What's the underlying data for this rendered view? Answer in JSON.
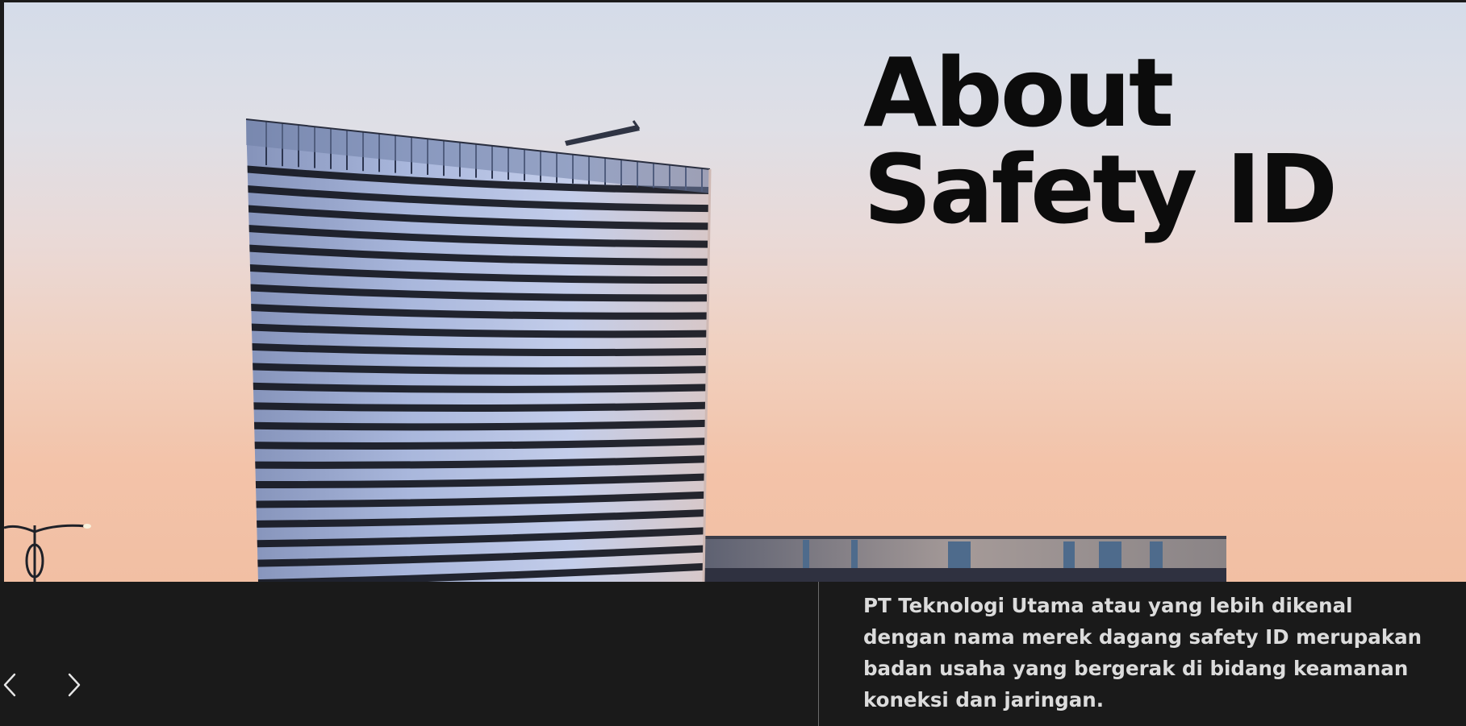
{
  "hero": {
    "title_line1": "About",
    "title_line2": "Safety ID"
  },
  "about": {
    "description": "PT Teknologi Utama atau yang lebih dikenal dengan nama merek dagang safety ID merupakan badan usaha yang bergerak di bidang keamanan koneksi dan jaringan."
  },
  "carousel": {
    "prev_icon": "chevron-left-icon",
    "next_icon": "chevron-right-icon"
  },
  "colors": {
    "panel_background": "#1a1a1a",
    "title_text": "#0c0c0c",
    "description_text": "#dcdcdc",
    "divider": "#6b6b6b"
  }
}
